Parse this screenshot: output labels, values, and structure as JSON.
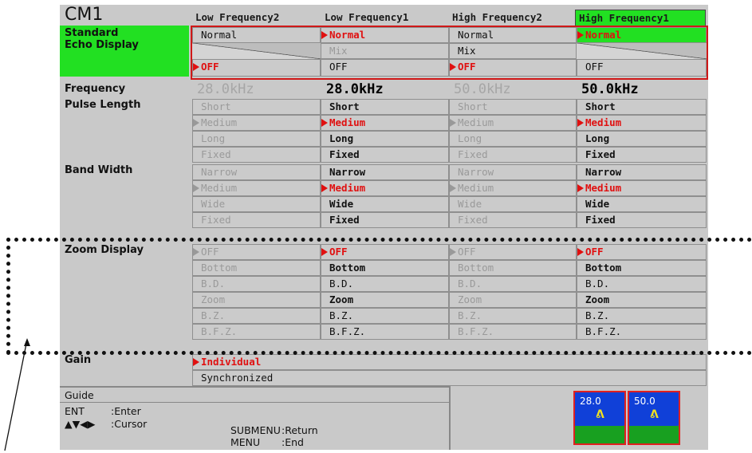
{
  "title": "CM1",
  "headers": [
    "Low Frequency2",
    "Low Frequency1",
    "High Frequency2",
    "High Frequency1"
  ],
  "rows": {
    "standard": "Standard\nEcho Display",
    "frequency": "Frequency",
    "pulse_length": "Pulse Length",
    "band_width": "Band Width",
    "zoom_display": "Zoom Display",
    "gain": "Gain"
  },
  "echo": {
    "normal": "Normal",
    "mix": "Mix",
    "off": "OFF"
  },
  "frequencies": [
    "28.0kHz",
    "28.0kHz",
    "50.0kHz",
    "50.0kHz"
  ],
  "pulse_options": [
    "Short",
    "Medium",
    "Long",
    "Fixed"
  ],
  "band_options": [
    "Narrow",
    "Medium",
    "Wide",
    "Fixed"
  ],
  "zoom_options": [
    "OFF",
    "Bottom",
    "B.D.",
    "Zoom",
    "B.Z.",
    "B.F.Z."
  ],
  "gain_options": [
    "Individual",
    "Synchronized"
  ],
  "guide": {
    "title": "Guide",
    "ent_key": "ENT",
    "ent_action": ":Enter",
    "cursor_key": "▲▼◀▶",
    "cursor_action": ":Cursor",
    "submenu_key": "SUBMENU",
    "submenu_action": ":Return",
    "menu_key": "MENU",
    "menu_action": ":End"
  },
  "thumbs": [
    "28.0",
    "50.0"
  ],
  "colors": {
    "highlight_green": "#22e022",
    "selected_red": "#e01010",
    "thumb_blue": "#1040d8"
  }
}
